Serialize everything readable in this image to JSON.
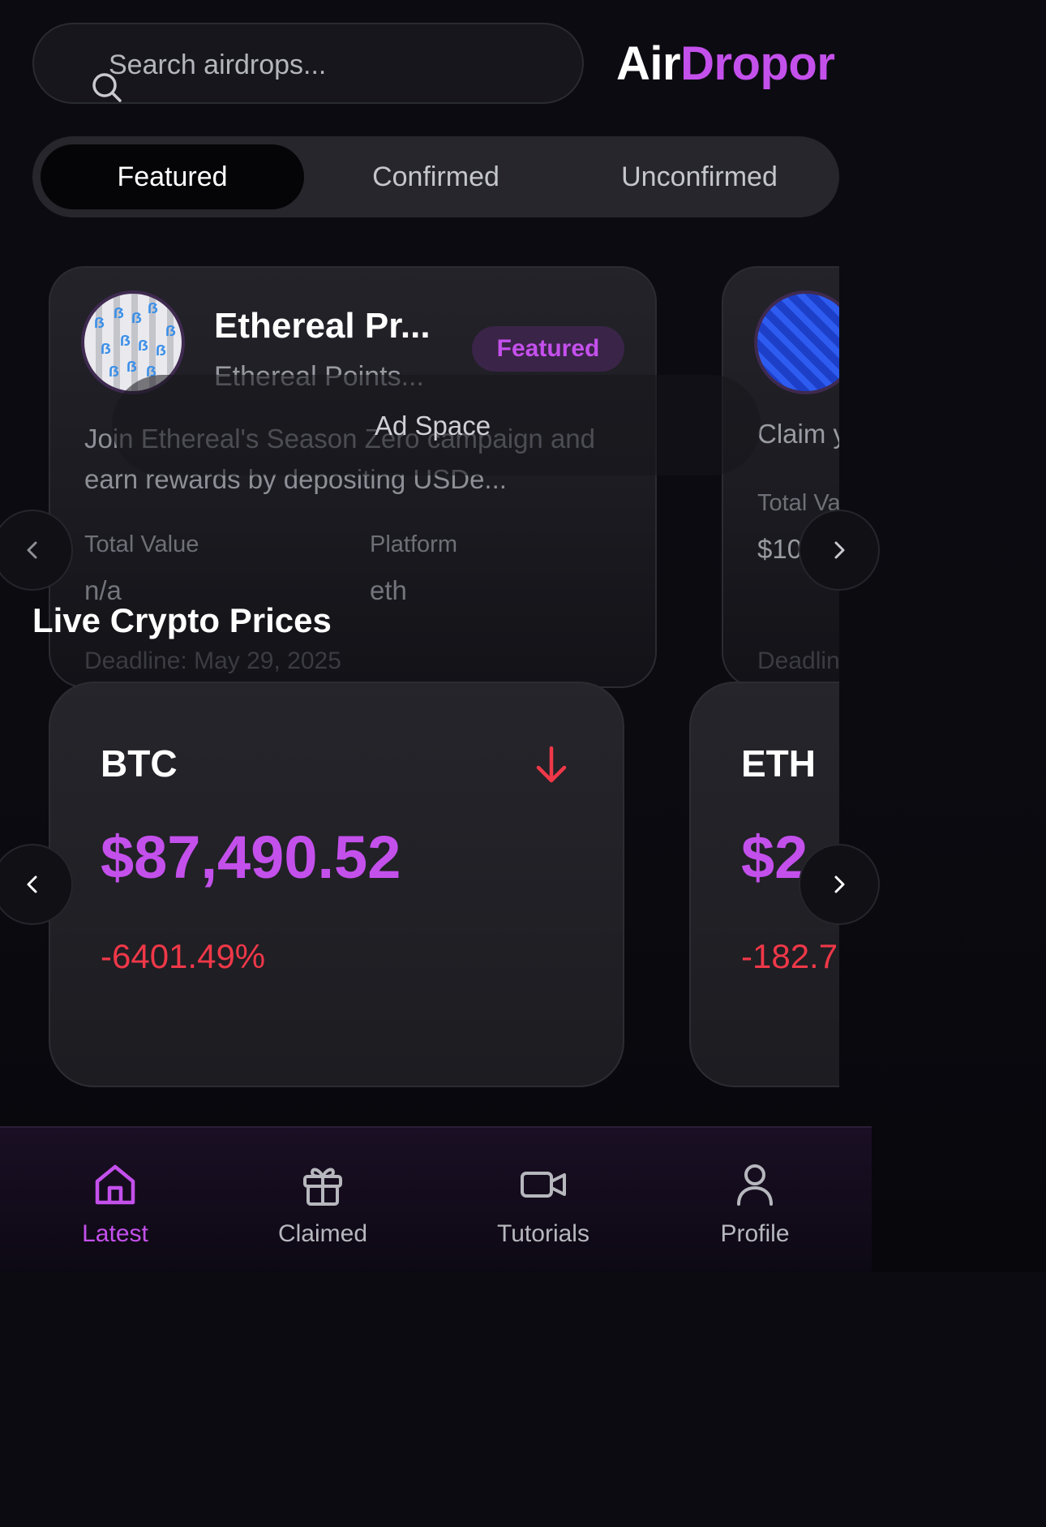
{
  "search": {
    "placeholder": "Search airdrops..."
  },
  "logo": {
    "part1": "Air",
    "part2": "Dropor"
  },
  "tabs": [
    {
      "label": "Featured",
      "active": true
    },
    {
      "label": "Confirmed",
      "active": false
    },
    {
      "label": "Unconfirmed",
      "active": false
    }
  ],
  "airdrops": [
    {
      "title": "Ethereal Pr...",
      "subtitle": "Ethereal Points...",
      "badge": "Featured",
      "description": "Join Ethereal's Season Zero campaign and earn rewards by depositing USDe...",
      "total_value_label": "Total Value",
      "total_value": "n/a",
      "platform_label": "Platform",
      "platform": "eth",
      "deadline": "Deadline: May 29, 2025"
    },
    {
      "description": "Claim y",
      "total_value_label": "Total Va",
      "total_value": "$10",
      "deadline": "Deadlin"
    }
  ],
  "ad": {
    "label": "Ad Space"
  },
  "prices_section": {
    "title": "Live Crypto Prices"
  },
  "prices": [
    {
      "symbol": "BTC",
      "price": "$87,490.52",
      "change": "-6401.49%",
      "direction": "down"
    },
    {
      "symbol": "ETH",
      "price": "$2",
      "change": "-182.7"
    }
  ],
  "bottom_nav": [
    {
      "label": "Latest",
      "icon": "home-icon",
      "active": true
    },
    {
      "label": "Claimed",
      "icon": "gift-icon",
      "active": false
    },
    {
      "label": "Tutorials",
      "icon": "video-icon",
      "active": false
    },
    {
      "label": "Profile",
      "icon": "user-icon",
      "active": false
    }
  ],
  "colors": {
    "accent": "#c450ec",
    "negative": "#ef3848",
    "background": "#0c0b12"
  }
}
